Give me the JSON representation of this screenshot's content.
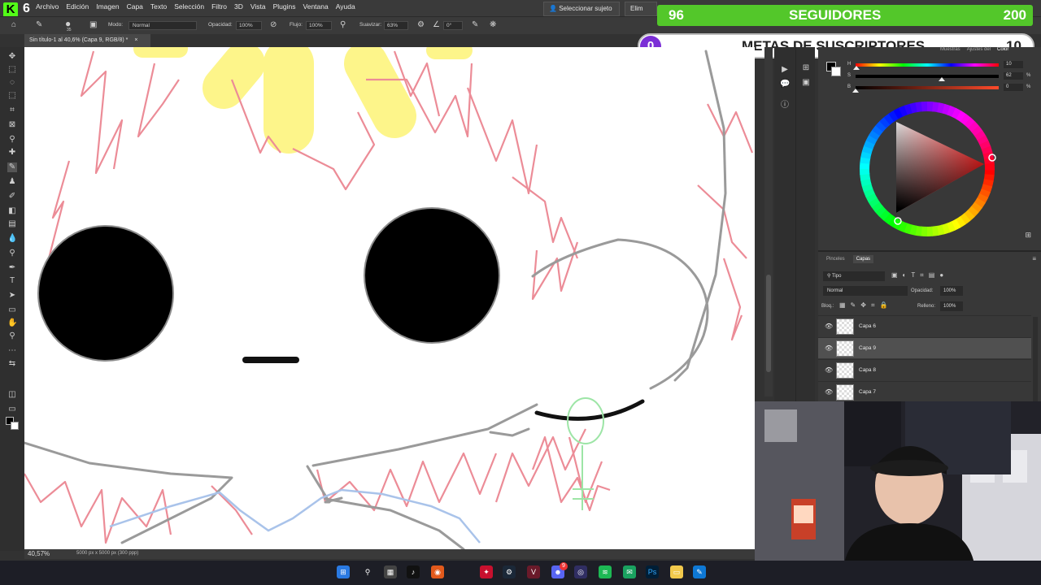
{
  "app": {
    "logo_letter": "K",
    "logo_number": "6",
    "menu": [
      "Archivo",
      "Edición",
      "Imagen",
      "Capa",
      "Texto",
      "Selección",
      "Filtro",
      "3D",
      "Vista",
      "Plugins",
      "Ventana",
      "Ayuda"
    ]
  },
  "options_bar": {
    "brush_size": "35",
    "mode_label": "Modo:",
    "mode_value": "Normal",
    "opacity_label": "Opacidad:",
    "opacity_value": "100%",
    "flow_label": "Flujo:",
    "flow_value": "100%",
    "smoothing_label": "Suavizar:",
    "smoothing_value": "63%",
    "angle_value": "0°",
    "select_subject": "Seleccionar sujeto",
    "remove_label": "Elim"
  },
  "overlay": {
    "followers_current": "96",
    "followers_label": "SEGUIDORES",
    "followers_goal": "200",
    "followers_color": "#53c72a",
    "subs_current": "0",
    "subs_label": "METAS DE SUSCRIPTORES",
    "subs_goal": "10",
    "subs_color": "#7b2ed6"
  },
  "document": {
    "tab_title": "Sin título-1 al 40,6% (Capa 9, RGB/8) *",
    "zoom": "40,57%",
    "info": "5000 px x 5000 px (300 ppp)"
  },
  "color_panel": {
    "tabs": [
      "Muestras",
      "Ajustes del",
      "Color"
    ],
    "active_tab": "Color",
    "h_label": "H",
    "h_value": "10",
    "s_label": "S",
    "s_value": "62",
    "b_label": "B",
    "b_value": "0",
    "s_unit": "%",
    "b_unit": "%",
    "foreground": "#000000",
    "background": "#ffffff",
    "hue_marker": "#ff3b1a"
  },
  "layers_panel": {
    "tabs": [
      "Pinceles",
      "Capas"
    ],
    "active_tab": "Capas",
    "filter": "Tipo",
    "blend_mode": "Normal",
    "opacity_label": "Opacidad:",
    "opacity_value": "100%",
    "lock_label": "Bloq.:",
    "fill_label": "Relleno:",
    "fill_value": "100%",
    "layers": [
      {
        "name": "Capa 6",
        "selected": false
      },
      {
        "name": "Capa 9",
        "selected": true
      },
      {
        "name": "Capa 8",
        "selected": false
      },
      {
        "name": "Capa 7",
        "selected": false
      }
    ]
  },
  "taskbar": {
    "icons": [
      "windows-icon",
      "search-icon",
      "apps-icon",
      "tiktok-icon",
      "firefox-icon",
      "red-app-icon",
      "steam-icon",
      "vegas-icon",
      "discord-icon",
      "obs-icon",
      "spotify-icon",
      "chat-icon",
      "photoshop-icon",
      "explorer-icon",
      "pen-icon"
    ],
    "discord_badge": "9"
  }
}
